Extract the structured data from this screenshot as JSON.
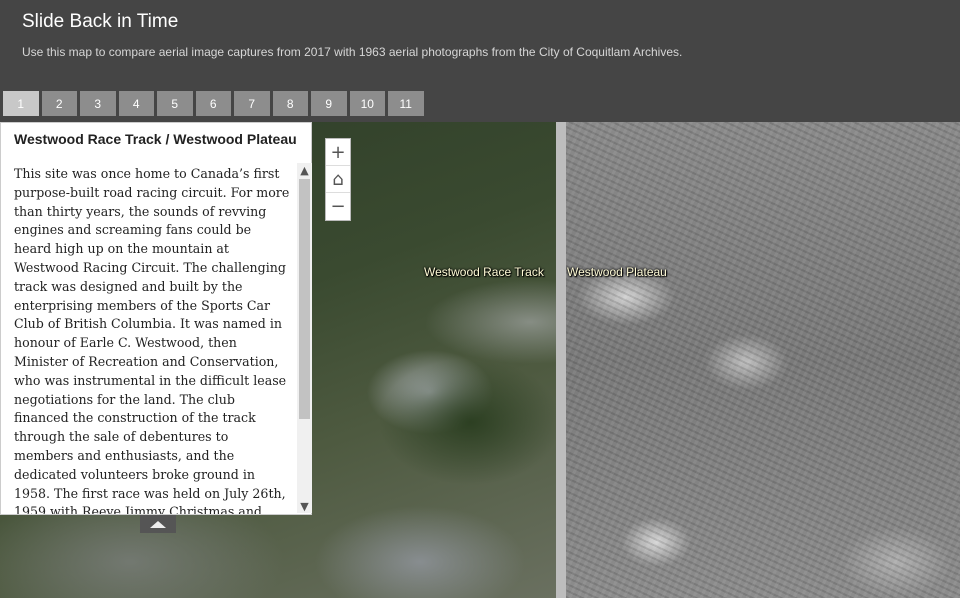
{
  "header": {
    "title": "Slide Back in Time",
    "subtitle": "Use this map to compare aerial image captures from 2017 with 1963 aerial photographs from the City of Coquitlam Archives."
  },
  "tabs": [
    {
      "label": "1",
      "active": true
    },
    {
      "label": "2"
    },
    {
      "label": "3"
    },
    {
      "label": "4"
    },
    {
      "label": "5"
    },
    {
      "label": "6"
    },
    {
      "label": "7"
    },
    {
      "label": "8"
    },
    {
      "label": "9"
    },
    {
      "label": "10"
    },
    {
      "label": "11"
    }
  ],
  "panel": {
    "title": "Westwood Race Track / Westwood Plateau",
    "body": "This site was once home to Canada’s first purpose-built road racing circuit. For more than thirty years, the sounds of revving engines and screaming fans could be heard high up on the mountain at Westwood Racing Circuit.  The challenging track was designed and built by the enterprising members of the Sports Car Club of British Columbia. It was named in honour of Earle C. Westwood, then Minister of Recreation and Conservation, who was instrumental in the difficult lease negotiations for the land. The club financed the construction of the track through the sale of debentures to members and enthusiasts, and the dedicated volunteers broke ground in 1958. The first race was held on July 26th, 1959 with Reeve Jimmy Christmas and Provincial Labour Minister Lyle Wicks on hand to cut the ribbon. The historic track was the site"
  },
  "map": {
    "label_left": "Westwood Race Track",
    "label_right": "Westwood Plateau",
    "zoom_in": "+",
    "home": "⌂",
    "zoom_out": "−"
  },
  "icons": {
    "scroll_up": "▲",
    "scroll_down": "▼"
  }
}
